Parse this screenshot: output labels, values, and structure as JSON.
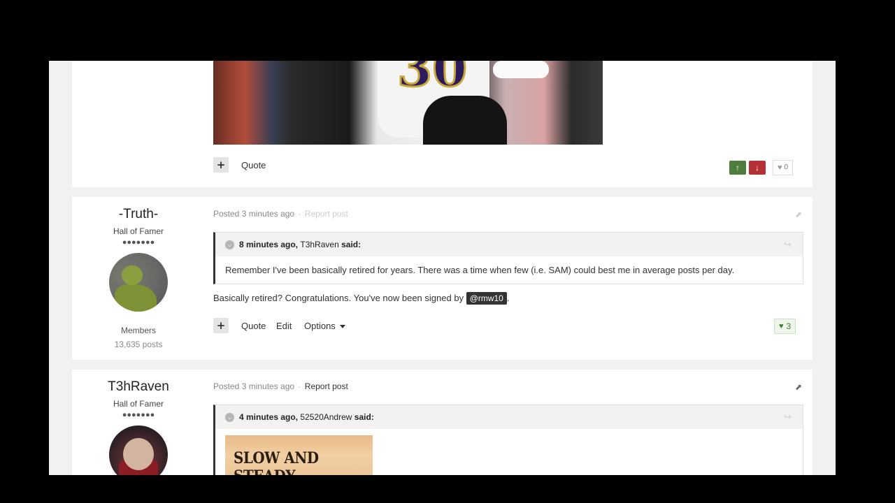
{
  "post1": {
    "actions": {
      "quote": "Quote"
    },
    "reputation": {
      "like_count": "0"
    }
  },
  "post2": {
    "author": {
      "name": "-Truth-",
      "rank": "Hall of Famer",
      "pips": "●●●●●●●",
      "group": "Members",
      "posts": "13,635 posts"
    },
    "meta": {
      "posted": "Posted",
      "time": "3 minutes ago",
      "sep": "·",
      "report": "Report post"
    },
    "quote": {
      "time": "8 minutes ago,",
      "user": "T3hRaven",
      "said": "said:",
      "text": "Remember I've been basically retired for years.  There was a time when few (i.e. SAM) could best me in average posts per day."
    },
    "body": {
      "before": "Basically retired? Congratulations. You've now been signed by ",
      "mention": "@rmw10",
      "after": "."
    },
    "actions": {
      "quote": "Quote",
      "edit": "Edit",
      "options": "Options"
    },
    "likes": "3"
  },
  "post3": {
    "author": {
      "name": "T3hRaven",
      "rank": "Hall of Famer",
      "pips": "●●●●●●●"
    },
    "meta": {
      "posted": "Posted",
      "time": "3 minutes ago",
      "sep": "·",
      "report": "Report post"
    },
    "quote": {
      "time": "4 minutes ago,",
      "user": "52520Andrew",
      "said": "said:",
      "image_text": "SLOW AND STEADY"
    }
  },
  "icons": {
    "plus": "+",
    "up": "▲",
    "down": "▼",
    "heart": "♥",
    "share": "share-icon",
    "chevron": "⌄",
    "reply_arrow": "↪"
  },
  "colors": {
    "upvote": "#4f7d3e",
    "downvote": "#b33034",
    "mention_bg": "#333333",
    "like_green": "#3e7d2e"
  }
}
